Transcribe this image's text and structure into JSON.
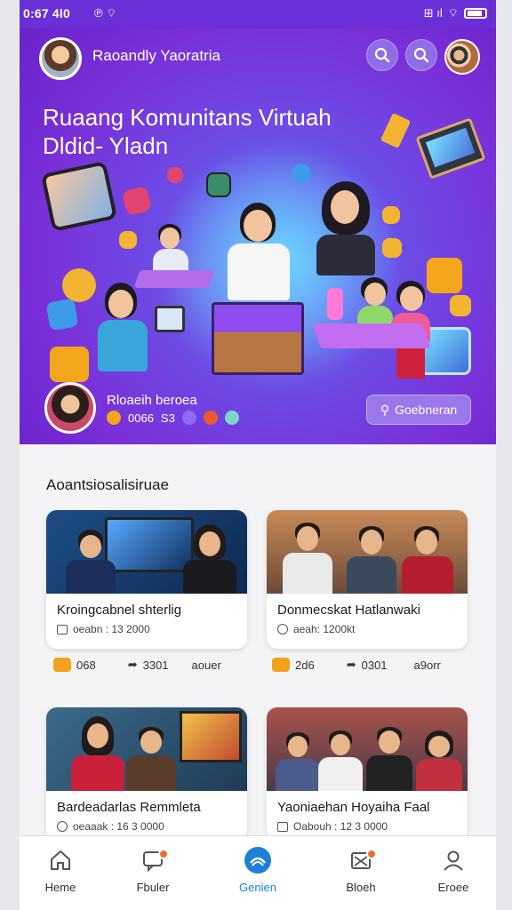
{
  "status_bar": {
    "time": "0:67 4l0",
    "extra": "℗ ",
    "right_extra": "⊞ ıl"
  },
  "header": {
    "app_name": "Raoandly Yaoratria",
    "headline_line1": "Ruaang Komunitans Virtuah",
    "headline_line2": "Dldid- Yladn"
  },
  "host": {
    "name": "Rloaeih beroea",
    "count": "0066",
    "extra": "S3"
  },
  "join_button": {
    "label": "Goebneran"
  },
  "section": {
    "title": "Aoantsiosalisiruae"
  },
  "cards": [
    {
      "title": "Kroingcabnel shterlig",
      "meta": "oeabn : 13 2000"
    },
    {
      "title": "Donmecskat Hatlanwaki",
      "meta": "aeah: 1200kt"
    },
    {
      "title": "Bardeadarlas Remmleta",
      "meta": "oeaaak : 16 3 0000"
    },
    {
      "title": "Yaoniaehan Hoyaiha Faal",
      "meta": "Oabouh : 12 3 0000"
    }
  ],
  "card_stats": [
    {
      "likes": "068",
      "shares": "3301",
      "extra": "aouer"
    },
    {
      "likes": "2d6",
      "shares": "0301",
      "extra": "a9orr"
    }
  ],
  "bottom_nav": [
    {
      "label": "Heme",
      "icon": "home-icon",
      "active": false
    },
    {
      "label": "Fbuler",
      "icon": "chat-icon",
      "active": false
    },
    {
      "label": "Genien",
      "icon": "wave-icon",
      "active": true
    },
    {
      "label": "Bloeh",
      "icon": "inbox-icon",
      "active": false
    },
    {
      "label": "Eroee",
      "icon": "profile-icon",
      "active": false
    }
  ],
  "colors": {
    "primary": "#6a2fd6",
    "accent": "#1f7fd6",
    "badge": "#f26b2f"
  }
}
